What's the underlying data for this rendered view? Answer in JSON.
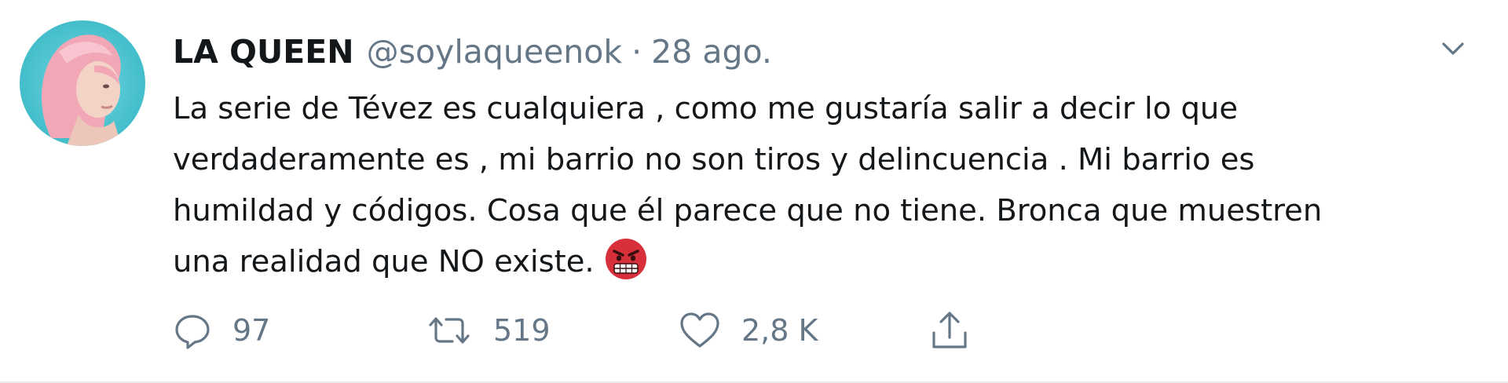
{
  "tweet": {
    "display_name": "LA QUEEN",
    "handle": "@soylaqueenok",
    "separator": "·",
    "date": "28 ago.",
    "text_lines": [
      "La serie de Tévez es cualquiera , como me gustaría salir a decir lo que",
      "verdaderamente es , mi barrio no son tiros y delincuencia . Mi barrio es",
      "humildad y códigos. Cosa que él parece que no tiene. Bronca que muestren",
      "una realidad que NO existe."
    ],
    "emoji": "angry-face-with-bandage-emoji",
    "avatar": "profile-avatar-pink-hair"
  },
  "actions": {
    "reply": {
      "icon": "reply-icon",
      "count": "97"
    },
    "retweet": {
      "icon": "retweet-icon",
      "count": "519"
    },
    "like": {
      "icon": "heart-icon",
      "count": "2,8 K"
    },
    "share": {
      "icon": "share-icon"
    }
  },
  "menu": {
    "icon": "chevron-down-icon"
  },
  "colors": {
    "text": "#14171a",
    "secondary": "#657786",
    "divider": "#e6ecf0"
  }
}
